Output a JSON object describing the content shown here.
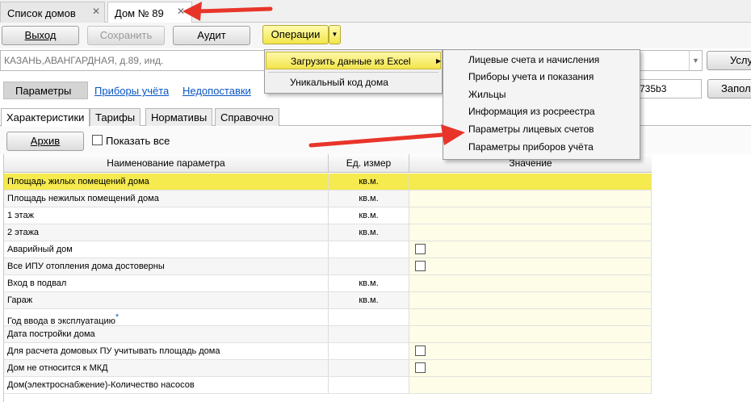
{
  "tabs": [
    {
      "label": "Список домов",
      "close": "✕"
    },
    {
      "label": "Дом № 89",
      "close": "✕"
    }
  ],
  "toolbar": {
    "exit_label": "Выход",
    "save_label": "Сохранить",
    "audit_label": "Аудит",
    "operations_label": "Операции",
    "operations_arrow": "▼"
  },
  "address": {
    "value": "КАЗАНЬ,АВАНГАРДНАЯ, д.89, инд.",
    "dropdown_arrow": "▼",
    "services_button": "Услу"
  },
  "section": {
    "params_label": "Параметры",
    "link_meters": "Приборы учёта",
    "link_shortfalls": "Недопоставки",
    "id_value": "735b3",
    "fill_button": "Запол"
  },
  "subtabs": [
    "Характеристики",
    "Тарифы",
    "Нормативы",
    "Справочно"
  ],
  "archive": {
    "button_label": "Архив",
    "show_all_label": "Показать все"
  },
  "grid": {
    "headers": [
      "Наименование параметра",
      "Ед. измер",
      "Значение"
    ],
    "rows": [
      {
        "name": "Площадь жилых помещений дома",
        "unit": "кв.м.",
        "checkbox": false
      },
      {
        "name": "Площадь нежилых помещений дома",
        "unit": "кв.м.",
        "checkbox": false
      },
      {
        "name": "1 этаж",
        "unit": "кв.м.",
        "checkbox": false
      },
      {
        "name": "2 этажа",
        "unit": "кв.м.",
        "checkbox": false
      },
      {
        "name": "Аварийный дом",
        "unit": "",
        "checkbox": true
      },
      {
        "name": "Все ИПУ отопления дома достоверны",
        "unit": "",
        "checkbox": true
      },
      {
        "name": "Вход в подвал",
        "unit": "кв.м.",
        "checkbox": false
      },
      {
        "name": "Гараж",
        "unit": "кв.м.",
        "checkbox": false
      },
      {
        "name": "Год ввода в эксплуатацию",
        "unit": "",
        "checkbox": false,
        "star": "*"
      },
      {
        "name": "Дата постройки дома",
        "unit": "",
        "checkbox": false
      },
      {
        "name": "Для расчета домовых ПУ учитывать площадь дома",
        "unit": "",
        "checkbox": true
      },
      {
        "name": "Дом не относится к МКД",
        "unit": "",
        "checkbox": true
      },
      {
        "name": "Дом(электроснабжение)-Количество насосов",
        "unit": "",
        "checkbox": false
      }
    ]
  },
  "operations_menu": {
    "items": [
      {
        "label": "Загрузить данные из Excel",
        "submenu_arrow": "▶"
      },
      {
        "label": "Уникальный код дома"
      }
    ]
  },
  "excel_submenu": {
    "items": [
      "Лицевые счета и начисления",
      "Приборы учета и показания",
      "Жильцы",
      "Информация из росреестра",
      "Параметры лицевых счетов",
      "Параметры приборов учёта"
    ]
  },
  "colors": {
    "highlight_yellow": "#f5ea4e",
    "annotation_arrow": "#e8352a",
    "link_blue": "#0b57c2"
  }
}
